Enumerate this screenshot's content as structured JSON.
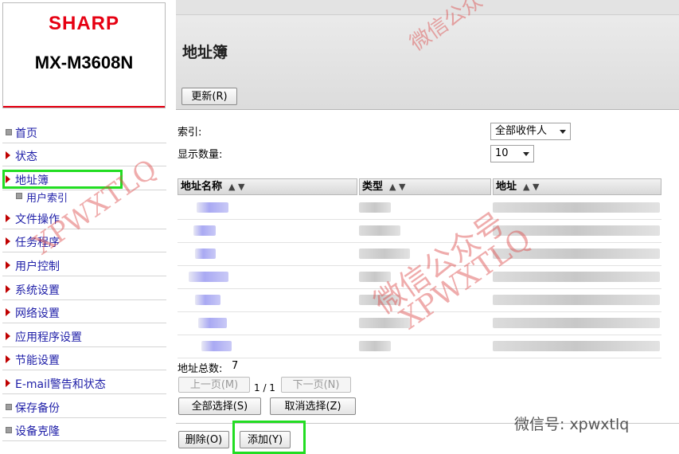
{
  "logo": {
    "brand": "SHARP",
    "model": "MX-M3608N"
  },
  "header": {
    "title": "地址簿",
    "refresh_label": "更新(R)"
  },
  "sidebar": {
    "items": [
      {
        "label": "首页",
        "marker": "square"
      },
      {
        "label": "状态",
        "marker": "arrow"
      },
      {
        "label": "地址簿",
        "marker": "arrow",
        "highlighted": true
      },
      {
        "label": "用户索引",
        "marker": "square"
      },
      {
        "label": "文件操作",
        "marker": "arrow"
      },
      {
        "label": "任务程序",
        "marker": "arrow"
      },
      {
        "label": "用户控制",
        "marker": "arrow"
      },
      {
        "label": "系统设置",
        "marker": "arrow"
      },
      {
        "label": "网络设置",
        "marker": "arrow"
      },
      {
        "label": "应用程序设置",
        "marker": "arrow"
      },
      {
        "label": "节能设置",
        "marker": "arrow"
      },
      {
        "label": "E-mail警告和状态",
        "marker": "arrow"
      },
      {
        "label": "保存备份",
        "marker": "square"
      },
      {
        "label": "设备克隆",
        "marker": "square"
      }
    ]
  },
  "filters": {
    "index_label": "索引:",
    "index_value": "全部收件人",
    "count_label": "显示数量:",
    "count_value": "10"
  },
  "table": {
    "columns": [
      {
        "label": "地址名称",
        "sort": "▲ ▼"
      },
      {
        "label": "类型",
        "sort": "▲ ▼"
      },
      {
        "label": "地址",
        "sort": "▲ ▼"
      }
    ],
    "rows_count": 7
  },
  "footer": {
    "total_label": "地址总数:",
    "total_value": "7",
    "prev_label": "上一页(M)",
    "page_info": "1 / 1",
    "next_label": "下一页(N)",
    "select_all_label": "全部选择(S)",
    "deselect_label": "取消选择(Z)",
    "delete_label": "删除(O)",
    "add_label": "添加(Y)"
  },
  "watermark": {
    "cn": "微信公众号",
    "en": "XPWXTLQ",
    "wechat": "微信号: xpwxtlq"
  },
  "colors": {
    "brand_red": "#e60012",
    "highlight_green": "#22dd22",
    "link_blue": "#1f1fa8"
  }
}
